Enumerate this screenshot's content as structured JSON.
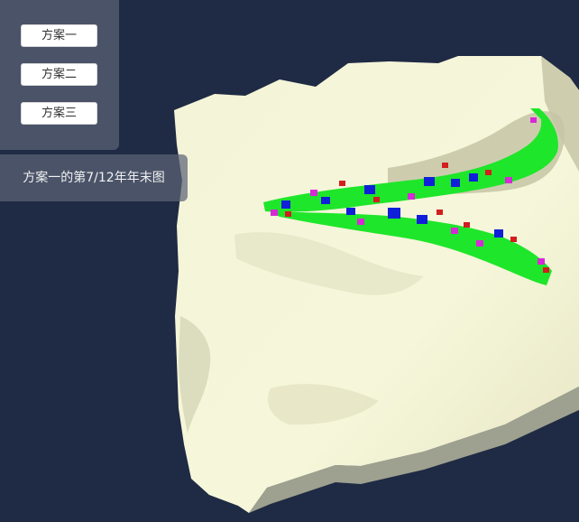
{
  "plan_panel": {
    "buttons": [
      {
        "label": "方案一"
      },
      {
        "label": "方案二"
      },
      {
        "label": "方案三"
      }
    ]
  },
  "caption": {
    "text": "方案一的第7/12年年末图"
  },
  "scene": {
    "background_color": "#1f2a44",
    "terrain_color": "#f3f3d2",
    "block_colors": {
      "primary": "#1ee62a",
      "secondary": "#1020d8",
      "accent_magenta": "#d62ad6",
      "accent_red": "#d21e1e"
    }
  }
}
